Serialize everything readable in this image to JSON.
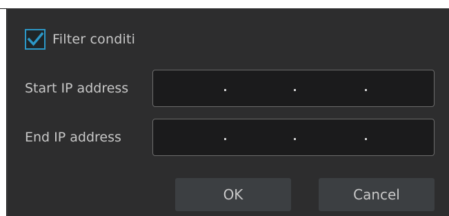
{
  "dialog": {
    "filter": {
      "checked": true,
      "label": "Filter conditi"
    },
    "start_ip": {
      "label": "Start IP address",
      "separator": "."
    },
    "end_ip": {
      "label": "End IP address",
      "separator": "."
    },
    "ok_label": "OK",
    "cancel_label": "Cancel"
  },
  "colors": {
    "background": "#2d2d2e",
    "accent": "#2c98c8",
    "field_bg": "#1b1b1c",
    "button_bg": "#3c3f42",
    "text": "#c8c8c8"
  },
  "icons": {
    "checkbox": "checkmark-icon"
  }
}
